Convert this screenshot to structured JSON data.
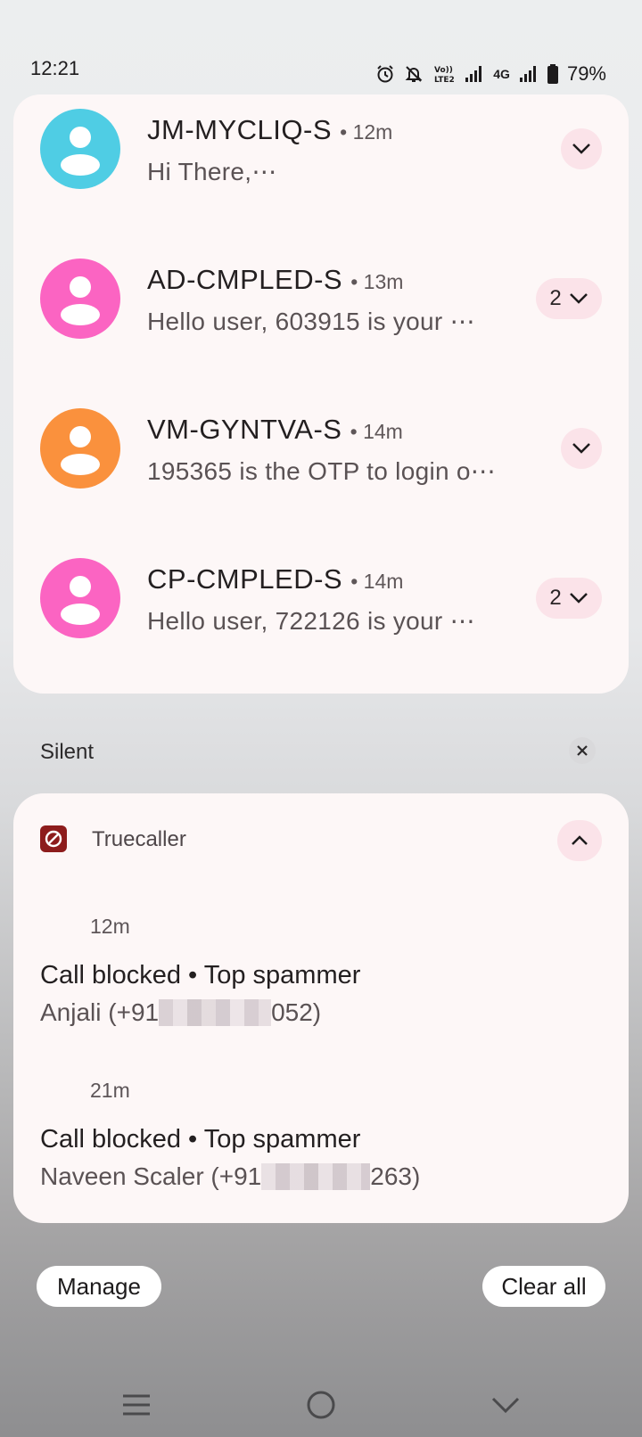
{
  "status_bar": {
    "time": "12:21",
    "network_label": "4G",
    "battery_percent": "79%",
    "icons": [
      "alarm-icon",
      "mute-bell-icon",
      "volte-icon",
      "signal-icon",
      "signal-icon",
      "battery-icon"
    ]
  },
  "notifications": [
    {
      "sender": "JM-MYCLIQ-S",
      "time": "• 12m",
      "snippet": "Hi There,⋯",
      "count": "",
      "avatar_color": "#4fcde4"
    },
    {
      "sender": "AD-CMPLED-S",
      "time": "• 13m",
      "snippet": "Hello user, 603915 is your ⋯",
      "count": "2",
      "avatar_color": "#fb64c2"
    },
    {
      "sender": "VM-GYNTVA-S",
      "time": "• 14m",
      "snippet": "195365 is the OTP to login o⋯",
      "count": "",
      "avatar_color": "#fa913d"
    },
    {
      "sender": "CP-CMPLED-S",
      "time": "• 14m",
      "snippet": "Hello user, 722126 is your ⋯",
      "count": "2",
      "avatar_color": "#fb64c2"
    }
  ],
  "silent": {
    "label": "Silent",
    "app": {
      "name": "Truecaller",
      "color": "#8d1c1c",
      "entries": [
        {
          "time": "12m",
          "title": "Call blocked • Top spammer",
          "name_prefix": "Anjali (+91",
          "number_suffix": "052)"
        },
        {
          "time": "21m",
          "title": "Call blocked • Top spammer",
          "name_prefix": "Naveen Scaler (+91",
          "number_suffix": "263)"
        }
      ]
    }
  },
  "actions": {
    "manage": "Manage",
    "clear_all": "Clear all"
  },
  "navbar": [
    "menu-icon",
    "home-icon",
    "back-chevron-icon"
  ]
}
